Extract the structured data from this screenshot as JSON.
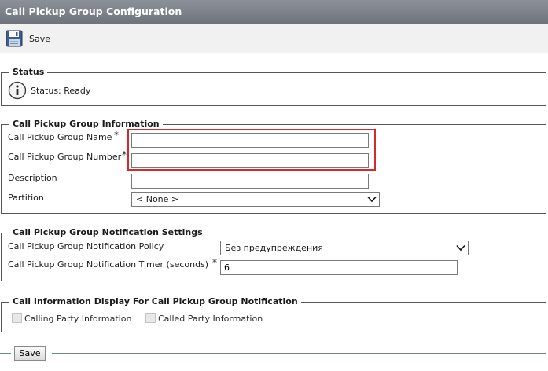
{
  "window": {
    "title": "Call Pickup Group Configuration"
  },
  "toolbar": {
    "save_label": "Save"
  },
  "status": {
    "legend": "Status",
    "text": "Status: Ready"
  },
  "info": {
    "legend": "Call Pickup Group Information",
    "name_label": "Call Pickup Group Name",
    "name_value": "",
    "number_label": "Call Pickup Group Number",
    "number_value": "",
    "description_label": "Description",
    "description_value": "",
    "partition_label": "Partition",
    "partition_value": "< None >",
    "required_mark": "*"
  },
  "notification": {
    "legend": "Call Pickup Group Notification Settings",
    "policy_label": "Call Pickup Group Notification Policy",
    "policy_value": "Без предупреждения",
    "timer_label": "Call Pickup Group Notification Timer (seconds)",
    "timer_value": "6",
    "required_mark": "*"
  },
  "display": {
    "legend": "Call Information Display For Call Pickup Group Notification",
    "calling_label": "Calling Party Information",
    "called_label": "Called Party Information"
  },
  "footer": {
    "save_label": "Save"
  },
  "colors": {
    "highlight": "#d62a2a",
    "titlebar": "#7a7e87"
  }
}
